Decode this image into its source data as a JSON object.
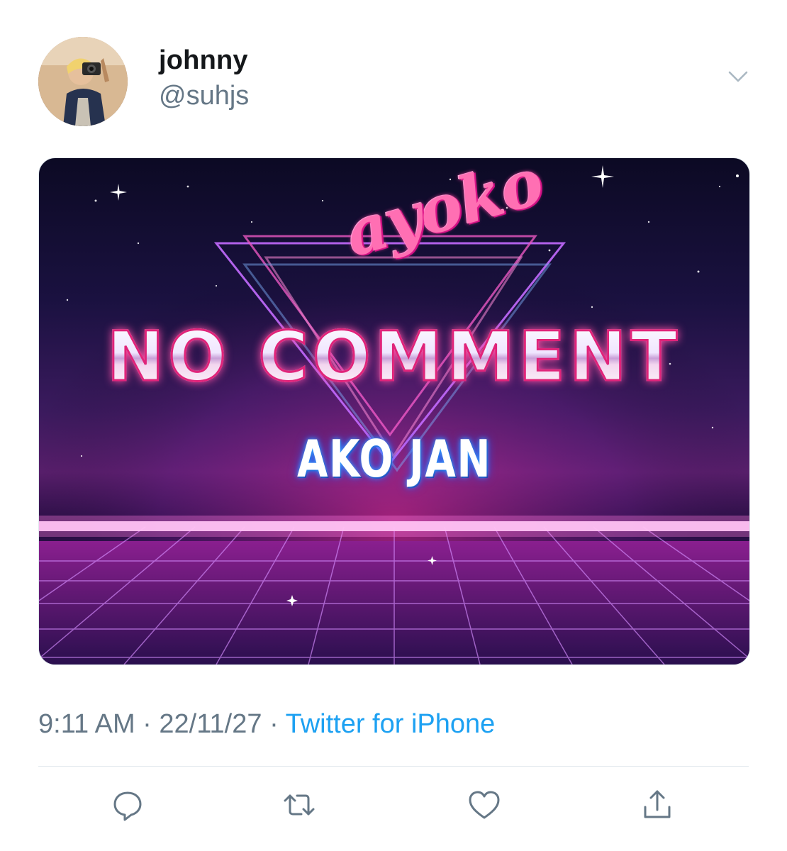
{
  "user": {
    "display_name": "johnny",
    "handle": "@suhjs"
  },
  "media": {
    "script_word": "ayoko",
    "headline": "NO COMMENT",
    "subline": "AKO JAN"
  },
  "meta": {
    "time": "9:11 AM",
    "separator": "·",
    "date": "22/11/27",
    "source": "Twitter for iPhone"
  },
  "icons": {
    "menu": "chevron-down-icon",
    "reply": "reply-icon",
    "retweet": "retweet-icon",
    "like": "heart-icon",
    "share": "share-icon"
  },
  "colors": {
    "link": "#1da1f2",
    "secondary_text": "#657786",
    "primary_text": "#14171a"
  }
}
